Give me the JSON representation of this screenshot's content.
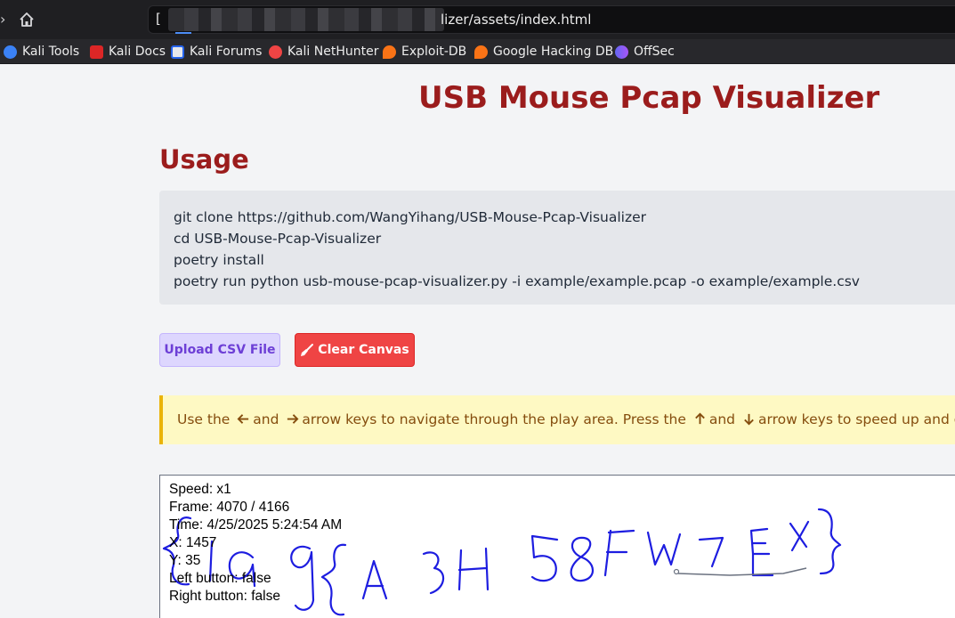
{
  "browser": {
    "url_prefix": "[",
    "url_visible": "lizer/assets/index.html",
    "bookmarks": [
      {
        "label": "Kali Tools",
        "icon": "kali-tools-icon"
      },
      {
        "label": "Kali Docs",
        "icon": "kali-docs-icon"
      },
      {
        "label": "Kali Forums",
        "icon": "kali-forums-icon"
      },
      {
        "label": "Kali NetHunter",
        "icon": "kali-nethunter-icon"
      },
      {
        "label": "Exploit-DB",
        "icon": "exploit-db-icon"
      },
      {
        "label": "Google Hacking DB",
        "icon": "google-hacking-db-icon"
      },
      {
        "label": "OffSec",
        "icon": "offsec-icon"
      }
    ]
  },
  "page": {
    "title": "USB Mouse Pcap Visualizer",
    "usage_heading": "Usage",
    "code_lines": [
      "git clone https://github.com/WangYihang/USB-Mouse-Pcap-Visualizer",
      "cd USB-Mouse-Pcap-Visualizer",
      "poetry install",
      "poetry run python usb-mouse-pcap-visualizer.py -i example/example.pcap -o example/example.csv"
    ],
    "upload_button": "Upload CSV File",
    "clear_button": "Clear Canvas",
    "notice": {
      "part1": "Use the",
      "part2": "and",
      "part3": "arrow keys to navigate through the play area. Press the",
      "part4": "and",
      "part5": "arrow keys to speed up and down."
    },
    "canvas_info": [
      "Speed: x1",
      "Frame: 4070 / 4166",
      "Time: 4/25/2025 5:24:54 AM",
      "X: 1457",
      "Y: 35",
      "Left button: false",
      "Right button: false"
    ]
  },
  "colors": {
    "title": "#9b1c1c",
    "stroke": "#1d1de0",
    "cursor_trail": "#6b7280"
  }
}
